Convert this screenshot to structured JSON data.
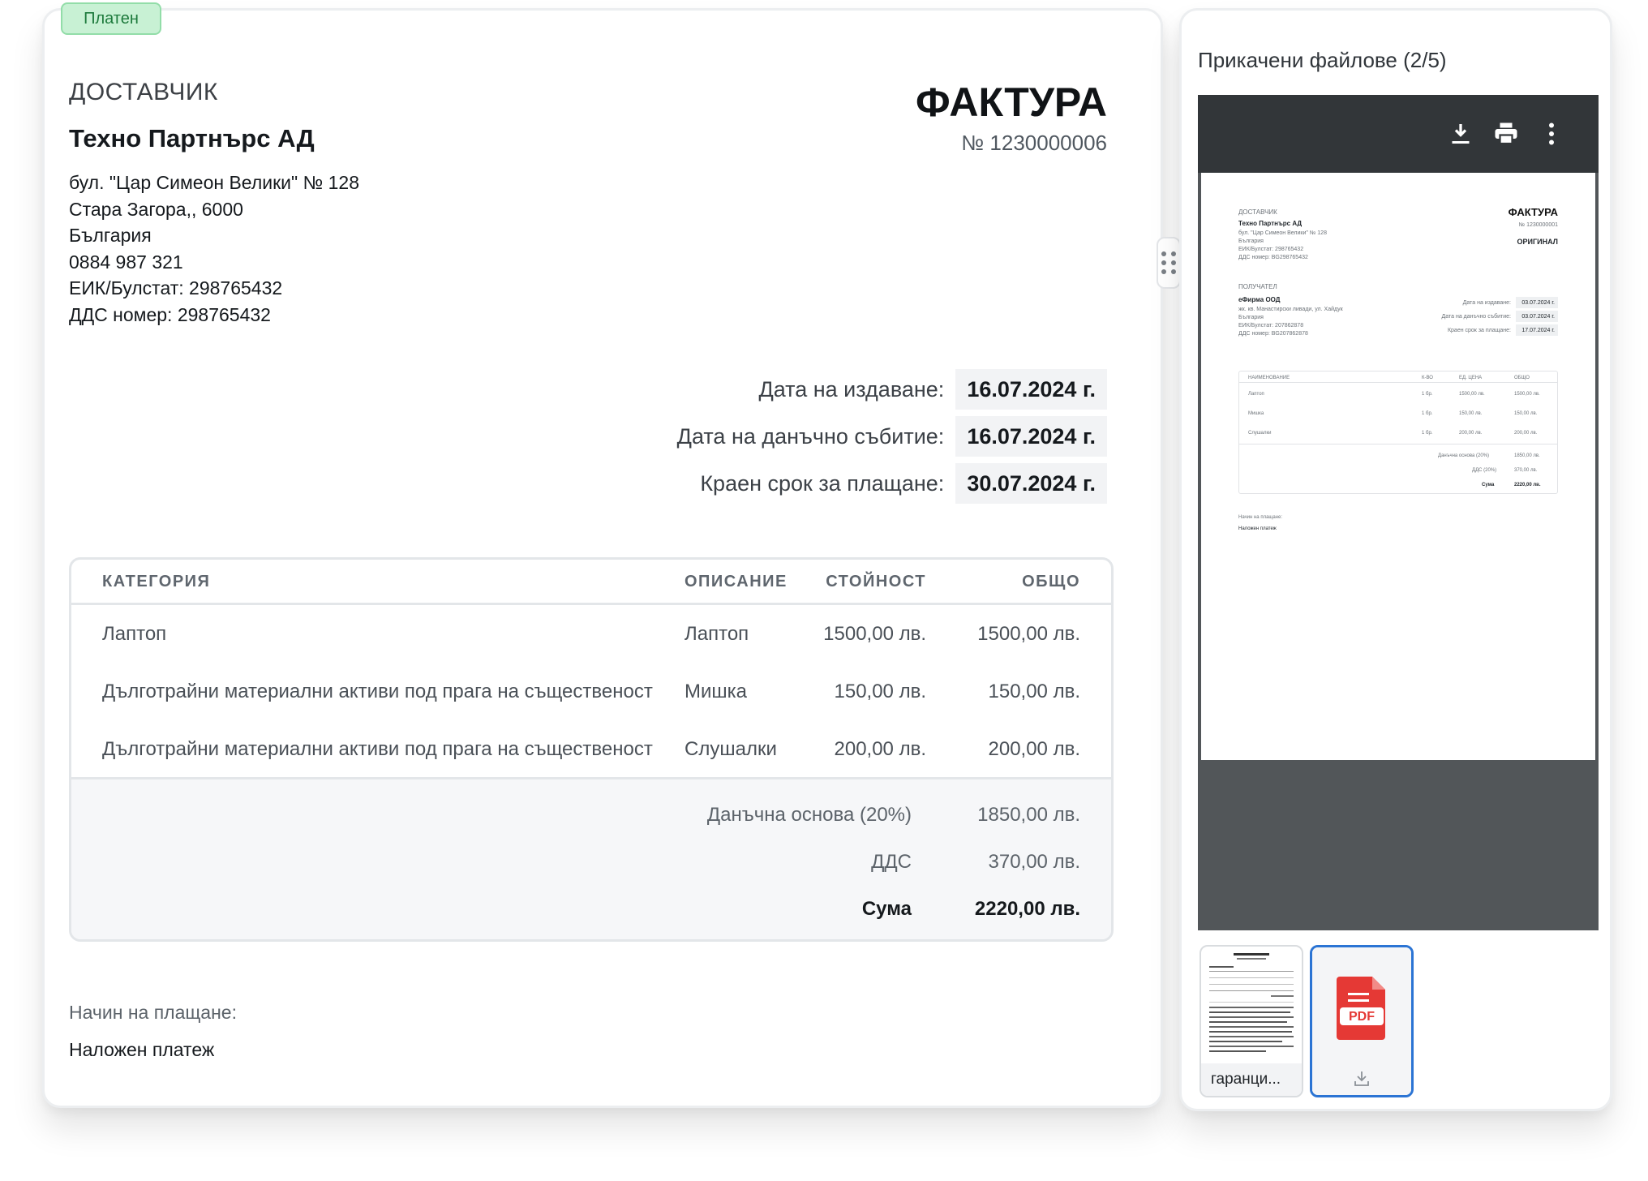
{
  "invoice": {
    "status_badge": "Платен",
    "supplier_heading": "ДОСТАВЧИК",
    "supplier_name": "Техно Партнърс АД",
    "supplier_lines": [
      "бул. \"Цар Симеон Велики\" № 128",
      "Стара Загора,, 6000",
      "България",
      "0884 987 321",
      "ЕИК/Булстат: 298765432",
      "ДДС номер: 298765432"
    ],
    "title": "ФАКТУРА",
    "number": "№ 1230000006",
    "dates": [
      {
        "label": "Дата на издаване:",
        "value": "16.07.2024 г."
      },
      {
        "label": "Дата на данъчно събитие:",
        "value": "16.07.2024 г."
      },
      {
        "label": "Краен срок за плащане:",
        "value": "30.07.2024 г."
      }
    ],
    "table": {
      "headers": [
        "КАТЕГОРИЯ",
        "ОПИСАНИЕ",
        "СТОЙНОСТ",
        "ОБЩО"
      ],
      "rows": [
        {
          "category": "Лаптоп",
          "description": "Лаптоп",
          "value": "1500,00 лв.",
          "total": "1500,00 лв."
        },
        {
          "category": "Дълготрайни материални активи под прага на същественост",
          "description": "Мишка",
          "value": "150,00 лв.",
          "total": "150,00 лв."
        },
        {
          "category": "Дълготрайни материални активи под прага на същественост",
          "description": "Слушалки",
          "value": "200,00 лв.",
          "total": "200,00 лв."
        }
      ],
      "totals": [
        {
          "label": "Данъчна основа (20%)",
          "value": "1850,00 лв."
        },
        {
          "label": "ДДС",
          "value": "370,00 лв."
        },
        {
          "label": "Сума",
          "value": "2220,00 лв."
        }
      ]
    },
    "payment_label": "Начин на плащане:",
    "payment_value": "Наложен платеж"
  },
  "attachments": {
    "title": "Прикачени файлове (2/5)",
    "viewer_toolbar": [
      "download-icon",
      "print-icon",
      "more-vertical-icon"
    ],
    "preview": {
      "supplier_heading": "ДОСТАВЧИК",
      "supplier_name": "Техно Партнърс АД",
      "supplier_lines": [
        "бул. \"Цар Симеон Велики\" № 128",
        "България",
        "ЕИК/Булстат: 298765432",
        "ДДС номер: BG298765432"
      ],
      "title": "ФАКТУРА",
      "number": "№ 1230000001",
      "original": "ОРИГИНАЛ",
      "recipient_heading": "ПОЛУЧАТЕЛ",
      "recipient_name": "еФирма ООД",
      "recipient_lines": [
        "жк. кв. Манастирски ливади, ул. Хайдук",
        "България",
        "ЕИК/Булстат: 207862878",
        "ДДС номер: BG207862878"
      ],
      "dates": [
        {
          "label": "Дата на издаване:",
          "value": "03.07.2024 г."
        },
        {
          "label": "Дата на данъчно събитие:",
          "value": "03.07.2024 г."
        },
        {
          "label": "Краен срок за плащане:",
          "value": "17.07.2024 г."
        }
      ],
      "headers": [
        "НАИМЕНОВАНИЕ",
        "К-ВО",
        "ЕД. ЦЕНА",
        "ОБЩО"
      ],
      "rows": [
        {
          "name": "Лаптоп",
          "qty": "1 бр.",
          "price": "1500,00 лв.",
          "total": "1500,00 лв."
        },
        {
          "name": "Мишка",
          "qty": "1 бр.",
          "price": "150,00 лв.",
          "total": "150,00 лв."
        },
        {
          "name": "Слушалки",
          "qty": "1 бр.",
          "price": "200,00 лв.",
          "total": "200,00 лв."
        }
      ],
      "totals": [
        {
          "label": "Данъчна основа (20%)",
          "value": "1850,00 лв."
        },
        {
          "label": "ДДС (20%)",
          "value": "370,00 лв."
        },
        {
          "label": "Сума",
          "value": "2220,00 лв."
        }
      ],
      "payment_label": "Начин на плащане:",
      "payment_value": "Наложен платеж"
    },
    "thumbnails": [
      {
        "label": "гаранци...",
        "type": "document"
      },
      {
        "label": "PDF",
        "type": "pdf",
        "icon": "download-icon"
      }
    ],
    "colors": {
      "selected_border": "#2b74d4",
      "pdf_red": "#e53935",
      "status_green": "#c8f1d4"
    }
  }
}
